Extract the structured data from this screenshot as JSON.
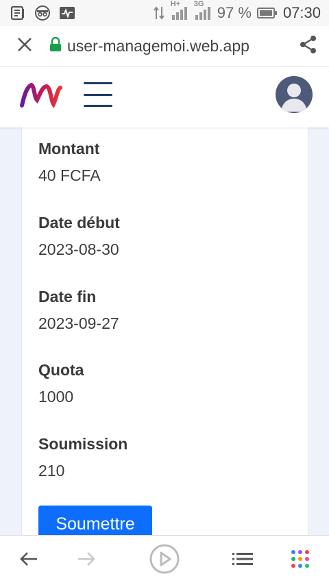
{
  "status_bar": {
    "battery_percent": "97 %",
    "time": "07:30",
    "network_a": "H+",
    "network_b": "3G",
    "icons": [
      "news-icon",
      "incognito-icon",
      "activity-icon",
      "data-arrows-icon",
      "signal-icon",
      "signal-icon",
      "battery-icon"
    ]
  },
  "browser": {
    "url": "user-managemoi.web.app",
    "icons": [
      "close-icon",
      "lock-icon",
      "share-icon"
    ]
  },
  "header": {
    "icons": [
      "logo-icon",
      "hamburger-menu-icon",
      "avatar-icon"
    ]
  },
  "details": [
    {
      "label": "Montant",
      "value": "40 FCFA"
    },
    {
      "label": "Date début",
      "value": "2023-08-30"
    },
    {
      "label": "Date fin",
      "value": "2023-09-27"
    },
    {
      "label": "Quota",
      "value": "1000"
    },
    {
      "label": "Soumission",
      "value": "210"
    }
  ],
  "submit_label": "Soumettre",
  "bottom_nav": {
    "icons": [
      "back-arrow-icon",
      "forward-arrow-icon",
      "play-icon",
      "list-icon",
      "apps-grid-icon"
    ]
  },
  "colors": {
    "primary_button": "#0d6efd",
    "hamburger": "#1b3a6b",
    "lock": "#1a9e4a",
    "page_bg": "#eef2fb"
  }
}
